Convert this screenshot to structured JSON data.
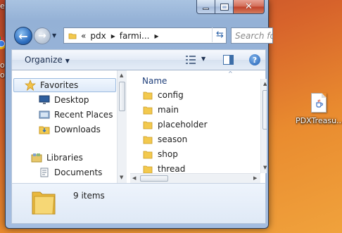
{
  "desktop": {
    "left_fragment_top": "es'",
    "left_fragment_mid": "og",
    "left_fragment_low": "or",
    "file_label": "PDXTreasu..."
  },
  "window": {
    "breadcrumb": [
      "pdx",
      "farmi..."
    ],
    "breadcrumb_prefix": "«",
    "search_placeholder": "Search fo",
    "toolbar": {
      "organize_label": "Organize"
    },
    "nav": {
      "favorites_label": "Favorites",
      "favorites_items": [
        "Desktop",
        "Recent Places",
        "Downloads"
      ],
      "libraries_label": "Libraries",
      "libraries_items": [
        "Documents"
      ]
    },
    "files": {
      "column_header": "Name",
      "items": [
        "config",
        "main",
        "placeholder",
        "season",
        "shop",
        "thread"
      ]
    },
    "details": {
      "item_count": "9 items"
    }
  },
  "colors": {
    "folder": "#f3c94e",
    "accent": "#2f6fc0",
    "close": "#c0412a"
  },
  "icons": [
    "back-icon",
    "forward-icon",
    "refresh-icon",
    "views-icon",
    "preview-pane-icon",
    "help-icon",
    "star-icon",
    "desktop-icon",
    "recent-places-icon",
    "downloads-icon",
    "libraries-icon",
    "documents-icon",
    "folder-icon",
    "java-file-icon",
    "chrome-icon"
  ]
}
